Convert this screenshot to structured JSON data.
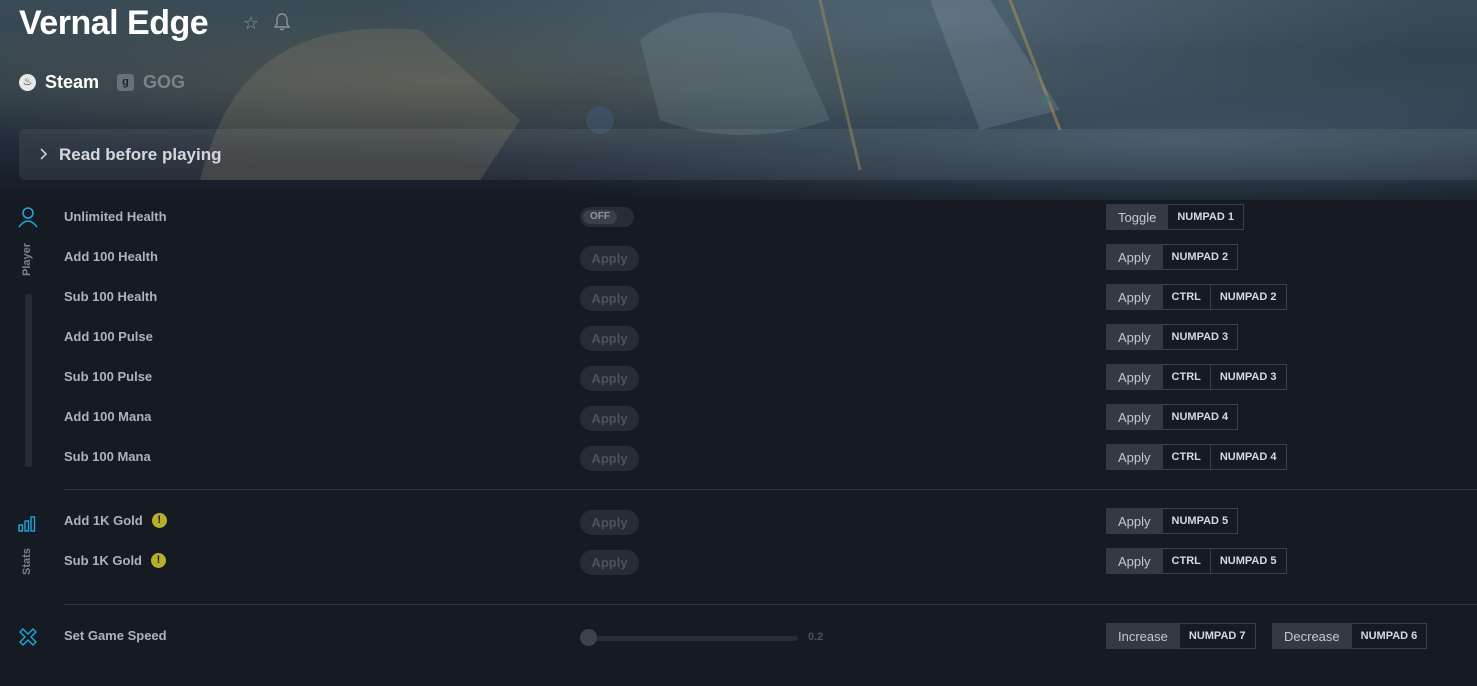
{
  "header": {
    "title": "Vernal Edge",
    "favorite_icon": "star-icon",
    "notify_icon": "bell-icon"
  },
  "platforms": [
    {
      "label": "Steam",
      "icon": "steam-icon",
      "active": true
    },
    {
      "label": "GOG",
      "icon": "gog-icon",
      "active": false
    }
  ],
  "read_before": {
    "label": "Read before playing"
  },
  "sections": {
    "player": "Player",
    "stats": "Stats"
  },
  "cheats": {
    "unlimited_health": {
      "name": "Unlimited Health",
      "state": "OFF",
      "action": "Toggle",
      "keys": [
        "NUMPAD 1"
      ]
    },
    "add_100_health": {
      "name": "Add 100 Health",
      "button": "Apply",
      "action": "Apply",
      "keys": [
        "NUMPAD 2"
      ]
    },
    "sub_100_health": {
      "name": "Sub 100 Health",
      "button": "Apply",
      "action": "Apply",
      "keys": [
        "CTRL",
        "NUMPAD 2"
      ]
    },
    "add_100_pulse": {
      "name": "Add 100 Pulse",
      "button": "Apply",
      "action": "Apply",
      "keys": [
        "NUMPAD 3"
      ]
    },
    "sub_100_pulse": {
      "name": "Sub 100 Pulse",
      "button": "Apply",
      "action": "Apply",
      "keys": [
        "CTRL",
        "NUMPAD 3"
      ]
    },
    "add_100_mana": {
      "name": "Add 100 Mana",
      "button": "Apply",
      "action": "Apply",
      "keys": [
        "NUMPAD 4"
      ]
    },
    "sub_100_mana": {
      "name": "Sub 100 Mana",
      "button": "Apply",
      "action": "Apply",
      "keys": [
        "CTRL",
        "NUMPAD 4"
      ]
    },
    "add_1k_gold": {
      "name": "Add 1K Gold",
      "warning": "!",
      "button": "Apply",
      "action": "Apply",
      "keys": [
        "NUMPAD 5"
      ]
    },
    "sub_1k_gold": {
      "name": "Sub 1K Gold",
      "warning": "!",
      "button": "Apply",
      "action": "Apply",
      "keys": [
        "CTRL",
        "NUMPAD 5"
      ]
    },
    "set_game_speed": {
      "name": "Set Game Speed",
      "value": "0.2",
      "increase": {
        "action": "Increase",
        "keys": [
          "NUMPAD 7"
        ]
      },
      "decrease": {
        "action": "Decrease",
        "keys": [
          "NUMPAD 6"
        ]
      }
    }
  },
  "colors": {
    "accent": "#1ea7d6",
    "warning": "#b8b02c",
    "background": "#151a23"
  }
}
